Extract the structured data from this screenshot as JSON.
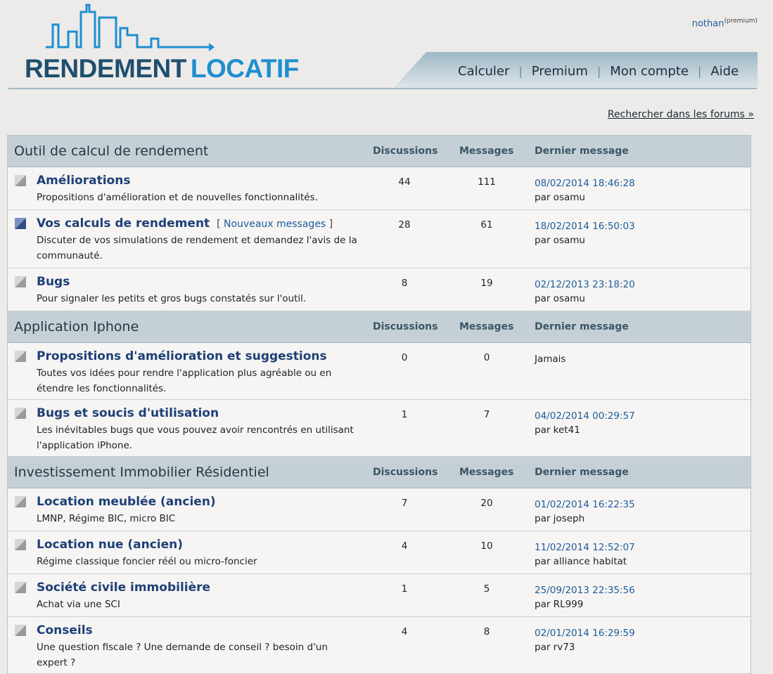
{
  "logo": {
    "word1": "RENDEMENT",
    "word2": "LOCATIF"
  },
  "user": {
    "name": "nothan",
    "badge": "(premium)"
  },
  "nav": [
    {
      "label": "Calculer"
    },
    {
      "label": "Premium"
    },
    {
      "label": "Mon compte"
    },
    {
      "label": "Aide"
    }
  ],
  "search_link": "Rechercher dans les forums »",
  "columns": {
    "discussions": "Discussions",
    "messages": "Messages",
    "last": "Dernier message"
  },
  "colors": {
    "accent": "#1e5c9b",
    "header_bg": "#c5d0d6",
    "page_bg": "#ecebe9"
  },
  "categories": [
    {
      "title": "Outil de calcul de rendement",
      "forums": [
        {
          "title": "Améliorations",
          "desc": "Propositions d'amélioration et de nouvelles fonctionnalités.",
          "discussions": "44",
          "messages": "111",
          "date": "08/02/2014 18:46:28",
          "by": "par osamu",
          "icon": "forum-read-icon"
        },
        {
          "title": "Vos calculs de rendement",
          "new_open": "[",
          "new_label": "Nouveaux messages",
          "new_close": "]",
          "desc": "Discuter de vos simulations de rendement et demandez l'avis de la communauté.",
          "discussions": "28",
          "messages": "61",
          "date": "18/02/2014 16:50:03",
          "by": "par osamu",
          "icon": "forum-unread-icon"
        },
        {
          "title": "Bugs",
          "desc": "Pour signaler les petits et gros bugs constatés sur l'outil.",
          "discussions": "8",
          "messages": "19",
          "date": "02/12/2013 23:18:20",
          "by": "par osamu",
          "icon": "forum-read-icon"
        }
      ]
    },
    {
      "title": "Application Iphone",
      "forums": [
        {
          "title": "Propositions d'amélioration et suggestions",
          "desc": "Toutes vos idées pour rendre l'application plus agréable ou en étendre les fonctionnalités.",
          "discussions": "0",
          "messages": "0",
          "date": "",
          "by": "",
          "never": "Jamais",
          "icon": "forum-read-icon"
        },
        {
          "title": "Bugs et soucis d'utilisation",
          "desc": "Les inévitables bugs que vous pouvez avoir rencontrés en utilisant l'application iPhone.",
          "discussions": "1",
          "messages": "7",
          "date": "04/02/2014 00:29:57",
          "by": "par ket41",
          "icon": "forum-read-icon"
        }
      ]
    },
    {
      "title": "Investissement Immobilier Résidentiel",
      "forums": [
        {
          "title": "Location meublée (ancien)",
          "desc": "LMNP, Régime BIC, micro BIC",
          "discussions": "7",
          "messages": "20",
          "date": "01/02/2014 16:22:35",
          "by": "par joseph",
          "icon": "forum-read-icon"
        },
        {
          "title": "Location nue (ancien)",
          "desc": "Régime classique foncier réél ou micro-foncier",
          "discussions": "4",
          "messages": "10",
          "date": "11/02/2014 12:52:07",
          "by": "par alliance habitat",
          "icon": "forum-read-icon"
        },
        {
          "title": "Société civile immobilière",
          "desc": "Achat via une SCI",
          "discussions": "1",
          "messages": "5",
          "date": "25/09/2013 22:35:56",
          "by": "par RL999",
          "icon": "forum-read-icon"
        },
        {
          "title": "Conseils",
          "desc": "Une question fiscale ? Une demande de conseil ? besoin d'un expert ?",
          "discussions": "4",
          "messages": "8",
          "date": "02/01/2014 16:29:59",
          "by": "par rv73",
          "icon": "forum-read-icon"
        }
      ]
    }
  ]
}
